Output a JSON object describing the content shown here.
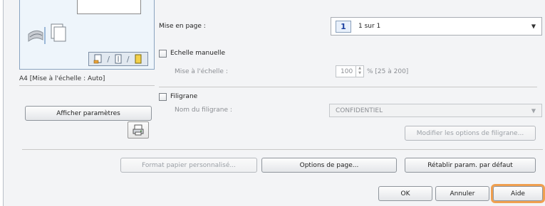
{
  "preview": {
    "caption": "A4 [Mise à l'échelle : Auto]",
    "toolbar_sep": "/"
  },
  "left": {
    "show_settings_button": "Afficher paramètres"
  },
  "layout": {
    "label": "Mise en page :",
    "value_number": "1",
    "value": "1 sur 1"
  },
  "manual_scaling": {
    "checkbox_label": "Echelle manuelle",
    "sub_label": "Mise à l'échelle :",
    "value": "100",
    "range": "% [25 à 200]"
  },
  "watermark": {
    "checkbox_label": "Filigrane",
    "name_label": "Nom du filigrane :",
    "value": "CONFIDENTIEL",
    "edit_button": "Modifier les options de filigrane..."
  },
  "actions": {
    "custom_paper": "Format papier personnalisé...",
    "page_options": "Options de page...",
    "restore_defaults": "Rétablir param. par défaut"
  },
  "footer": {
    "ok": "OK",
    "cancel": "Annuler",
    "help": "Aide"
  },
  "colors": {
    "highlight": "#f0a050",
    "page_icon_number": "#1a3fa0"
  }
}
